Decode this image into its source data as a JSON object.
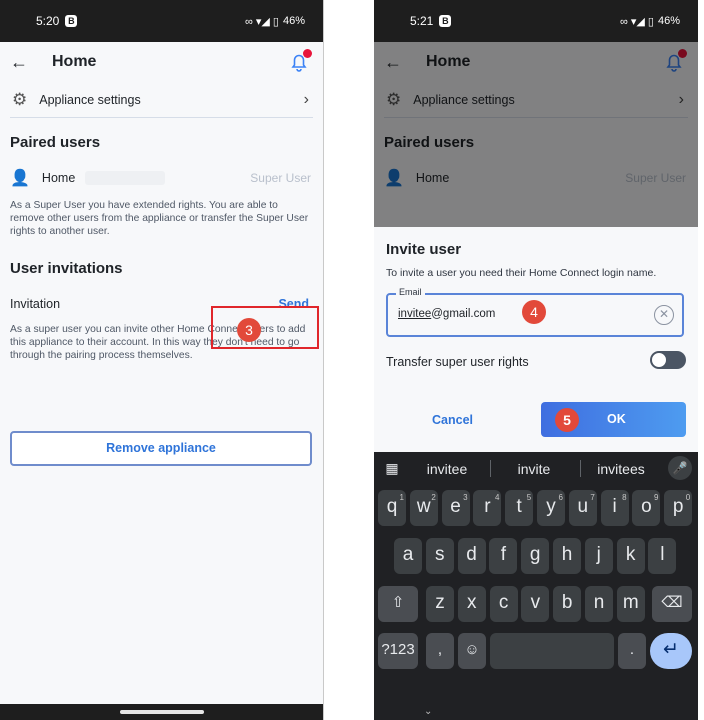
{
  "left": {
    "status_time": "5:20",
    "status_battery": "46%",
    "title": "Home",
    "appliance_settings": "Appliance settings",
    "paired_users_title": "Paired users",
    "user_name": "Home",
    "user_role": "Super User",
    "super_user_desc": "As a Super User you have extended rights. You are able to remove other users from the appliance or transfer the Super User rights to another user.",
    "invitations_title": "User invitations",
    "invitation_label": "Invitation",
    "send_label": "Send",
    "invite_desc": "As a super user you can invite other Home Connect users to add this appliance to their account. In this way they don't need to go through the pairing process themselves.",
    "remove_button": "Remove appliance",
    "step": "3"
  },
  "right": {
    "status_time": "5:21",
    "status_battery": "46%",
    "title": "Home",
    "appliance_settings": "Appliance settings",
    "paired_users_title": "Paired users",
    "user_name": "Home",
    "user_role": "Super User",
    "dialog": {
      "title": "Invite user",
      "subtitle": "To invite a user you need their Home Connect login name.",
      "email_label": "Email",
      "email_value_underlined": "invitee",
      "email_value_rest": "@gmail.com",
      "transfer_label": "Transfer super user rights",
      "transfer_on": false,
      "cancel": "Cancel",
      "ok": "OK",
      "step_email": "4",
      "step_ok": "5"
    },
    "keyboard": {
      "suggestions": [
        "invitee",
        "invite",
        "invitees"
      ],
      "row1": [
        "q",
        "w",
        "e",
        "r",
        "t",
        "y",
        "u",
        "i",
        "o",
        "p"
      ],
      "row1_hints": [
        "1",
        "2",
        "3",
        "4",
        "5",
        "6",
        "7",
        "8",
        "9",
        "0"
      ],
      "row2": [
        "a",
        "s",
        "d",
        "f",
        "g",
        "h",
        "j",
        "k",
        "l"
      ],
      "row3": [
        "z",
        "x",
        "c",
        "v",
        "b",
        "n",
        "m"
      ],
      "symbols": "?123",
      "comma": ",",
      "period": "."
    }
  }
}
